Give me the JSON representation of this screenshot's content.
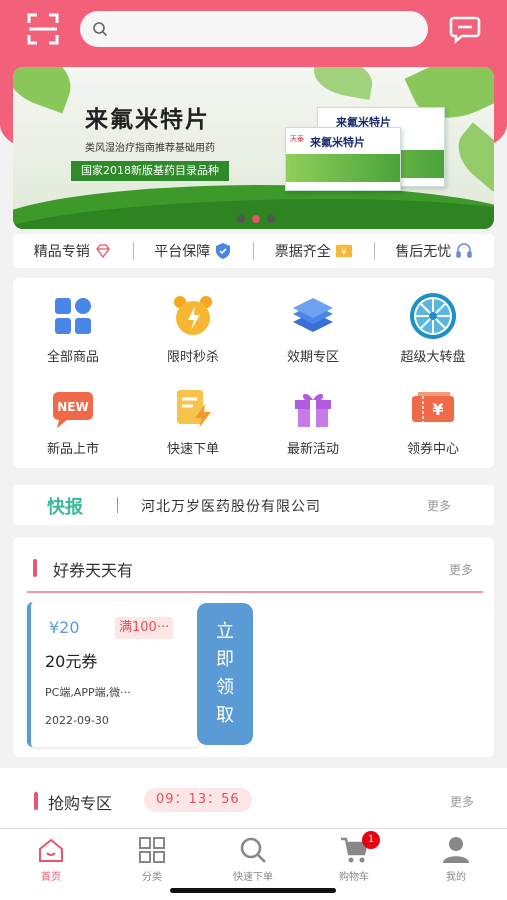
{
  "search": {
    "placeholder": ""
  },
  "banner": {
    "title": "来氟米特片",
    "subtitle": "类风湿治疗指南推荐基础用药",
    "tag": "国家2018新版基药目录品种",
    "box_name": "来氟米特片",
    "brand": "天泰",
    "slide_count": 3,
    "active_slide": 2
  },
  "features": [
    {
      "label": "精品专销",
      "icon": "diamond-icon"
    },
    {
      "label": "平台保障",
      "icon": "shield-icon"
    },
    {
      "label": "票据齐全",
      "icon": "invoice-icon"
    },
    {
      "label": "售后无忧",
      "icon": "headset-icon"
    }
  ],
  "grid": [
    {
      "label": "全部商品",
      "icon": "grid-icon"
    },
    {
      "label": "限时秒杀",
      "icon": "alarm-clock-icon"
    },
    {
      "label": "效期专区",
      "icon": "layers-icon"
    },
    {
      "label": "超级大转盘",
      "icon": "wheel-icon"
    },
    {
      "label": "新品上市",
      "icon": "new-icon"
    },
    {
      "label": "快速下单",
      "icon": "quick-order-icon"
    },
    {
      "label": "最新活动",
      "icon": "gift-icon"
    },
    {
      "label": "领券中心",
      "icon": "coupon-icon"
    }
  ],
  "news": {
    "tag": "快报",
    "text": "河北万岁医药股份有限公司",
    "more": "更多"
  },
  "coupons": {
    "title": "好券天天有",
    "more": "更多",
    "item": {
      "price": "¥20",
      "condition": "满100···",
      "name": "20元券",
      "scope": "PC端,APP端,微···",
      "date": "2022-09-30",
      "button_chars": [
        "立",
        "即",
        "领",
        "取"
      ]
    }
  },
  "flash": {
    "title": "抢购专区",
    "timer": "09：13：56",
    "more": "更多"
  },
  "tabbar": [
    {
      "label": "首页",
      "icon": "home-icon",
      "active": true
    },
    {
      "label": "分类",
      "icon": "category-icon",
      "active": false
    },
    {
      "label": "快速下单",
      "icon": "search-icon",
      "active": false
    },
    {
      "label": "购物车",
      "icon": "cart-icon",
      "active": false,
      "badge": "1"
    },
    {
      "label": "我的",
      "icon": "user-icon",
      "active": false
    }
  ],
  "colors": {
    "brand": "#f2607a",
    "accent": "#e8566d",
    "coupon_blue": "#5b9bd5",
    "news_green": "#3bb99a"
  }
}
